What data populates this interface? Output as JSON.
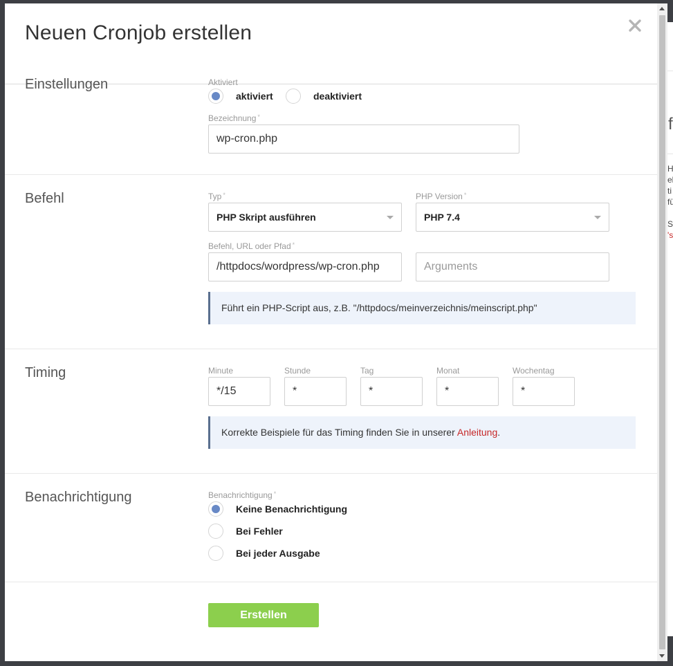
{
  "modal": {
    "title": "Neuen Cronjob erstellen",
    "submit_label": "Erstellen"
  },
  "settings": {
    "section_title": "Einstellungen",
    "active_label": "Aktiviert",
    "options": [
      {
        "label": "aktiviert",
        "checked": true
      },
      {
        "label": "deaktiviert",
        "checked": false
      }
    ],
    "name_label": "Bezeichnung",
    "name_value": "wp-cron.php"
  },
  "command": {
    "section_title": "Befehl",
    "type_label": "Typ",
    "type_value": "PHP Skript ausführen",
    "php_version_label": "PHP Version",
    "php_version_value": "PHP 7.4",
    "path_label": "Befehl, URL oder Pfad",
    "path_value": "/httpdocs/wordpress/wp-cron.php",
    "arguments_placeholder": "Arguments",
    "info": "Führt ein PHP-Script aus, z.B. \"/httpdocs/meinverzeichnis/meinscript.php\""
  },
  "timing": {
    "section_title": "Timing",
    "fields": [
      {
        "label": "Minute",
        "value": "*/15"
      },
      {
        "label": "Stunde",
        "value": "*"
      },
      {
        "label": "Tag",
        "value": "*"
      },
      {
        "label": "Monat",
        "value": "*"
      },
      {
        "label": "Wochentag",
        "value": "*"
      }
    ],
    "info_prefix": "Korrekte Beispiele für das Timing finden Sie in unserer ",
    "info_link": "Anleitung",
    "info_suffix": "."
  },
  "notification": {
    "section_title": "Benachrichtigung",
    "label": "Benachrichtigung",
    "options": [
      {
        "label": "Keine Benachrichtigung",
        "checked": true
      },
      {
        "label": "Bei Fehler",
        "checked": false
      },
      {
        "label": "Bei jeder Ausgabe",
        "checked": false
      }
    ]
  },
  "required_marker": "*",
  "background_fragments": {
    "heading": "f",
    "lines": [
      "H",
      "eh",
      "ti",
      "fü"
    ],
    "lower": "Sp",
    "red": "'s"
  },
  "colors": {
    "accent_radio": "#6889c6",
    "submit_button": "#8ccf4d",
    "link": "#c62828",
    "info_bg": "#eef3fb",
    "info_border": "#5a6f8f"
  }
}
